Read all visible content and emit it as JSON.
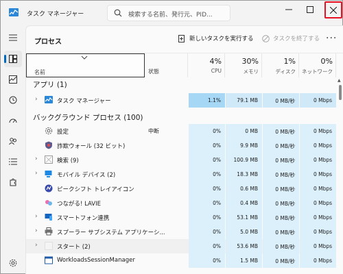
{
  "window": {
    "title": "タスク マネージャー"
  },
  "search": {
    "placeholder": "検索する名前、発行元、PID..."
  },
  "page": {
    "title": "プロセス"
  },
  "commands": {
    "new_task": "新しいタスクを実行する",
    "end_task": "タスクを終了する",
    "more": "···"
  },
  "columns": {
    "name": "名前",
    "status": "状態",
    "cpu": {
      "pct": "4%",
      "label": "CPU"
    },
    "memory": {
      "pct": "30%",
      "label": "メモリ"
    },
    "disk": {
      "pct": "1%",
      "label": "ディスク"
    },
    "network": {
      "pct": "0%",
      "label": "ネットワーク"
    }
  },
  "sections": {
    "apps": "アプリ (1)",
    "background": "バックグラウンド プロセス (100)"
  },
  "apps": [
    {
      "name": "タスク マネージャー",
      "status": "",
      "cpu": "1.1%",
      "mem": "79.1 MB",
      "disk": "0 MB/秒",
      "net": "0 Mbps",
      "icon": "task-manager-icon"
    }
  ],
  "background": [
    {
      "name": "設定",
      "status": "中断",
      "cpu": "0%",
      "mem": "0 MB",
      "disk": "0 MB/秒",
      "net": "0 Mbps",
      "icon": "settings-gear-icon"
    },
    {
      "name": "詐欺ウォール (32 ビット)",
      "status": "",
      "cpu": "0%",
      "mem": "9.9 MB",
      "disk": "0 MB/秒",
      "net": "0 Mbps",
      "icon": "shield-app-icon"
    },
    {
      "name": "検索 (9)",
      "status": "",
      "cpu": "0%",
      "mem": "100.9 MB",
      "disk": "0 MB/秒",
      "net": "0 Mbps",
      "icon": "search-app-icon"
    },
    {
      "name": "モバイル デバイス (2)",
      "status": "",
      "cpu": "0%",
      "mem": "18.3 MB",
      "disk": "0 MB/秒",
      "net": "0 Mbps",
      "icon": "mobile-devices-icon"
    },
    {
      "name": "ピークシフト トレイアイコン",
      "status": "",
      "cpu": "0%",
      "mem": "0.6 MB",
      "disk": "0 MB/秒",
      "net": "0 Mbps",
      "icon": "peak-shift-icon"
    },
    {
      "name": "つながる! LAVIE",
      "status": "",
      "cpu": "0%",
      "mem": "0.4 MB",
      "disk": "0 MB/秒",
      "net": "0 Mbps",
      "icon": "lavie-icon"
    },
    {
      "name": "スマートフォン連携",
      "status": "",
      "cpu": "0%",
      "mem": "53.1 MB",
      "disk": "0 MB/秒",
      "net": "0 Mbps",
      "icon": "phone-link-icon"
    },
    {
      "name": "スプーラー サブシステム アプリケーシ...",
      "status": "",
      "cpu": "0%",
      "mem": "5.0 MB",
      "disk": "0 MB/秒",
      "net": "0 Mbps",
      "icon": "printer-icon"
    },
    {
      "name": "スタート (2)",
      "status": "",
      "cpu": "0%",
      "mem": "53.6 MB",
      "disk": "0 MB/秒",
      "net": "0 Mbps",
      "icon": "start-icon"
    },
    {
      "name": "WorkloadsSessionManager",
      "status": "",
      "cpu": "0%",
      "mem": "1.5 MB",
      "disk": "0 MB/秒",
      "net": "0 Mbps",
      "icon": "app-window-icon"
    }
  ]
}
